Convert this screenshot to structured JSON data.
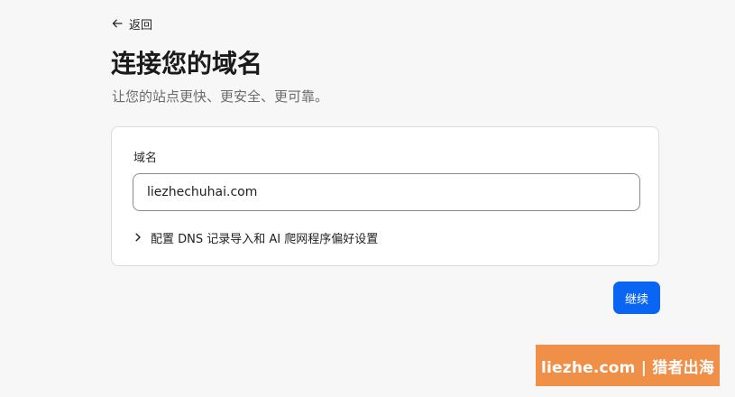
{
  "nav": {
    "back_label": "返回",
    "back_icon": "arrow-left-icon"
  },
  "header": {
    "title": "连接您的域名",
    "subtitle": "让您的站点更快、更安全、更可靠。"
  },
  "form": {
    "domain_label": "域名",
    "domain_value": "liezhechuhai.com",
    "advanced_label": "配置 DNS 记录导入和 AI 爬网程序偏好设置",
    "advanced_icon": "chevron-right-icon"
  },
  "actions": {
    "continue_label": "继续",
    "primary_color": "#0a66f2"
  },
  "watermark": {
    "text": "liezhe.com | 猎者出海",
    "color": "#f08f48"
  }
}
